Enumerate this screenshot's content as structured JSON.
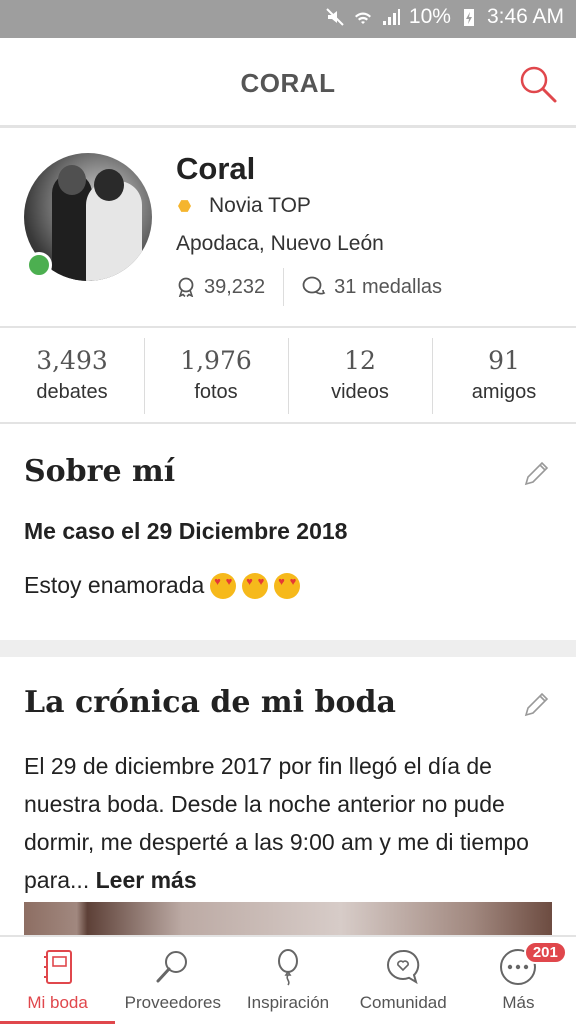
{
  "status_bar": {
    "battery": "10%",
    "time": "3:46 AM"
  },
  "app_bar": {
    "title": "CORAL"
  },
  "profile": {
    "name": "Coral",
    "rank": "Novia TOP",
    "location": "Apodaca, Nuevo León",
    "points": "39,232",
    "medals": "31 medallas"
  },
  "counts": [
    {
      "value": "3,493",
      "label": "debates"
    },
    {
      "value": "1,976",
      "label": "fotos"
    },
    {
      "value": "12",
      "label": "videos"
    },
    {
      "value": "91",
      "label": "amigos"
    }
  ],
  "about": {
    "title": "Sobre mí",
    "wedding_date": "Me caso el 29 Diciembre 2018",
    "status": "Estoy enamorada"
  },
  "chronicle": {
    "title": "La crónica de mi boda",
    "text": "El 29 de diciembre 2017 por fin llegó el día de nuestra boda. Desde la noche anterior no pude dormir, me desperté a las 9:00 am y me di tiempo para...",
    "more": "Leer más"
  },
  "bottom_nav": {
    "items": [
      {
        "label": "Mi boda",
        "icon": "notebook-icon"
      },
      {
        "label": "Proveedores",
        "icon": "magnifier-icon"
      },
      {
        "label": "Inspiración",
        "icon": "balloon-icon"
      },
      {
        "label": "Comunidad",
        "icon": "chat-heart-icon"
      },
      {
        "label": "Más",
        "icon": "more-dots-icon",
        "badge": "201"
      }
    ]
  },
  "colors": {
    "accent": "#e0474c",
    "rank": "#f5b52e",
    "online": "#4caf50"
  }
}
